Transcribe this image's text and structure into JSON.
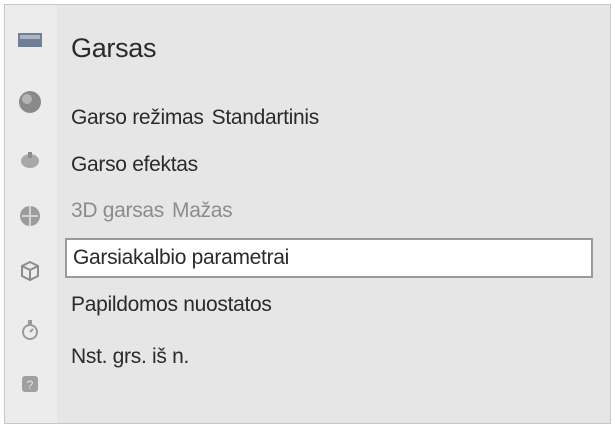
{
  "menu": {
    "title": "Garsas",
    "items": [
      {
        "label": "Garso režimas",
        "value": "Standartinis"
      },
      {
        "label": "Garso efektas",
        "value": ""
      },
      {
        "label": "3D garsas",
        "value": "Mažas"
      },
      {
        "label": "Garsiakalbio parametrai",
        "value": ""
      },
      {
        "label": "Papildomos nuostatos",
        "value": ""
      },
      {
        "label": "Nst. grs. iš n.",
        "value": ""
      }
    ],
    "selected_item": "Garsiakalbio parametrai",
    "disabled_item": "3D garsas"
  },
  "sidebar": {
    "icons": [
      "picture-icon",
      "sound-icon",
      "broadcast-icon",
      "network-icon",
      "system-icon",
      "support-icon",
      "help-icon"
    ]
  },
  "colors": {
    "background": "#e6e6e6",
    "text": "#2a2a2a",
    "disabled_text": "#8c8c8c",
    "selection_fill": "#ffffff",
    "selection_border": "#9a9a9a"
  }
}
